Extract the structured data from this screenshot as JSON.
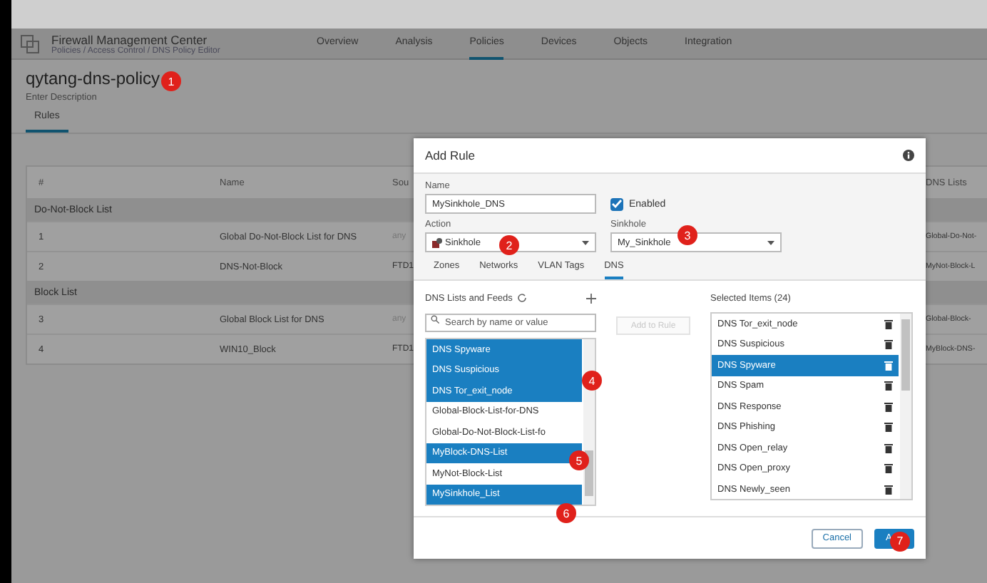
{
  "header": {
    "product": "Firewall Management Center",
    "breadcrumb": "Policies / Access Control / DNS Policy Editor",
    "nav": [
      {
        "label": "Overview",
        "selected": false
      },
      {
        "label": "Analysis",
        "selected": false
      },
      {
        "label": "Policies",
        "selected": true
      },
      {
        "label": "Devices",
        "selected": false
      },
      {
        "label": "Objects",
        "selected": false
      },
      {
        "label": "Integration",
        "selected": false
      }
    ]
  },
  "policy": {
    "name": "qytang-dns-policy",
    "badge": "1",
    "description": "Enter Description",
    "tabs": [
      {
        "label": "Rules",
        "selected": true
      }
    ]
  },
  "table": {
    "columns": [
      "#",
      "Name",
      "Sou",
      "DNS Lists"
    ],
    "rows": [
      {
        "kind": "group",
        "label": "Do-Not-Block List"
      },
      {
        "kind": "rule",
        "cells": [
          "1",
          "Global Do-Not-Block List for DNS",
          "any",
          "Global-Do-Not-"
        ]
      },
      {
        "kind": "rule",
        "cells": [
          "2",
          "DNS-Not-Block",
          "FTD1",
          "MyNot-Block-L"
        ]
      },
      {
        "kind": "group",
        "label": "Block List"
      },
      {
        "kind": "rule",
        "cells": [
          "3",
          "Global Block List for DNS",
          "any",
          "Global-Block-"
        ]
      },
      {
        "kind": "rule",
        "cells": [
          "4",
          "WIN10_Block",
          "FTD1",
          "MyBlock-DNS-"
        ]
      }
    ]
  },
  "dialog": {
    "title": "Add Rule",
    "name": {
      "label": "Name",
      "value": "MySinkhole_DNS"
    },
    "enabled": {
      "label": "Enabled",
      "checked": true
    },
    "action": {
      "label": "Action",
      "value": "Sinkhole",
      "badge": "2"
    },
    "sinkhole": {
      "label": "Sinkhole",
      "value": "My_Sinkhole",
      "badge": "3"
    },
    "tabs": [
      {
        "label": "Zones",
        "selected": false
      },
      {
        "label": "Networks",
        "selected": false
      },
      {
        "label": "VLAN Tags",
        "selected": false
      },
      {
        "label": "DNS",
        "selected": true
      }
    ],
    "available": {
      "title": "DNS Lists and Feeds",
      "search_placeholder": "Search by name or value",
      "items": [
        {
          "label": "DNS Spyware",
          "selected": true
        },
        {
          "label": "DNS Suspicious",
          "selected": true
        },
        {
          "label": "DNS Tor_exit_node",
          "selected": true,
          "badge": "4"
        },
        {
          "label": "Global-Block-List-for-DNS",
          "selected": false
        },
        {
          "label": "Global-Do-Not-Block-List-fo",
          "selected": false
        },
        {
          "label": "MyBlock-DNS-List",
          "selected": true,
          "badge": "5"
        },
        {
          "label": "MyNot-Block-List",
          "selected": false
        },
        {
          "label": "MySinkhole_List",
          "selected": true,
          "badge": "6"
        }
      ]
    },
    "add_to_rule": {
      "label": "Add to Rule",
      "disabled": true
    },
    "selected": {
      "title": "Selected Items (24)",
      "items": [
        {
          "label": "DNS Tor_exit_node",
          "selected": false
        },
        {
          "label": "DNS Suspicious",
          "selected": false
        },
        {
          "label": "DNS Spyware",
          "selected": true
        },
        {
          "label": "DNS Spam",
          "selected": false
        },
        {
          "label": "DNS Response",
          "selected": false
        },
        {
          "label": "DNS Phishing",
          "selected": false
        },
        {
          "label": "DNS Open_relay",
          "selected": false
        },
        {
          "label": "DNS Open_proxy",
          "selected": false
        },
        {
          "label": "DNS Newly_seen",
          "selected": false
        }
      ]
    },
    "buttons": [
      {
        "kind": "secondary",
        "label": "Cancel"
      },
      {
        "kind": "primary",
        "label": "A",
        "badge": "7"
      }
    ]
  }
}
